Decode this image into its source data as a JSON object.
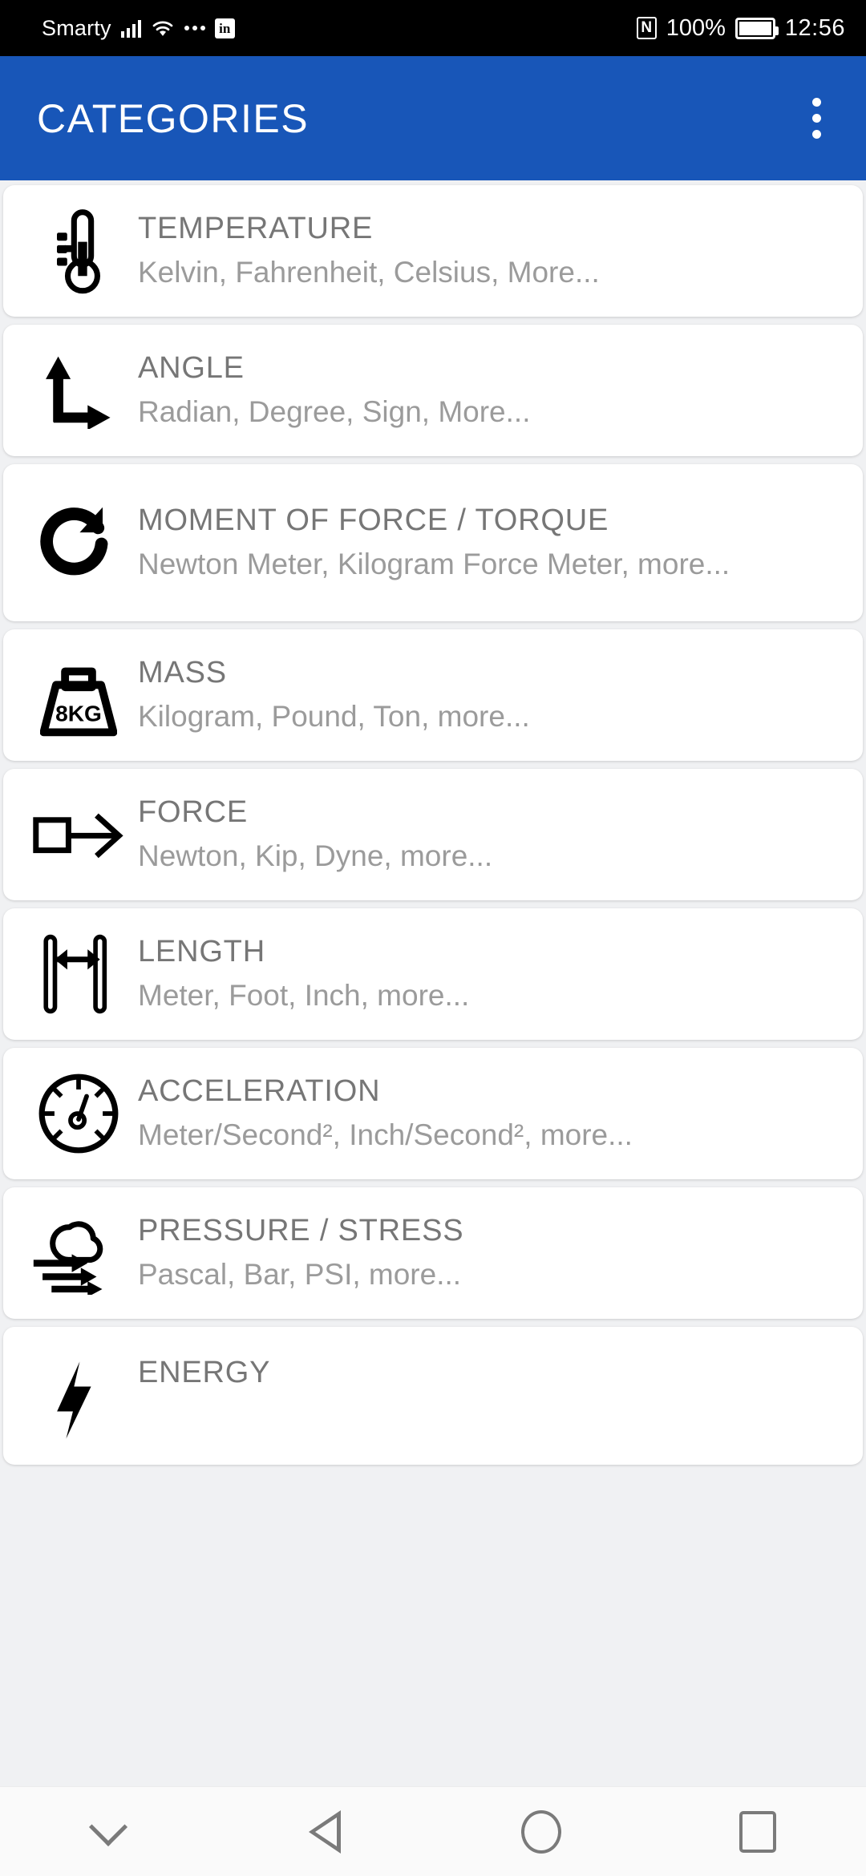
{
  "status_bar": {
    "carrier": "Smarty",
    "icons": [
      "signal-icon",
      "wifi-icon",
      "dots-icon",
      "linkedin-icon"
    ],
    "linkedin_label": "in",
    "nfc_label": "N",
    "battery_percent": "100%",
    "time": "12:56"
  },
  "app_bar": {
    "title": "CATEGORIES",
    "overflow_label": "more-options",
    "background_color": "#1856b8",
    "title_color": "#ffffff"
  },
  "list": {
    "items": [
      {
        "icon": "thermometer-icon",
        "title": "TEMPERATURE",
        "subtitle": "Kelvin, Fahrenheit, Celsius, More..."
      },
      {
        "icon": "angle-arrows-icon",
        "title": "ANGLE",
        "subtitle": "Radian, Degree, Sign, More..."
      },
      {
        "icon": "rotation-arrow-icon",
        "title": "MOMENT OF FORCE / TORQUE",
        "subtitle": "Newton Meter, Kilogram Force Meter, more..."
      },
      {
        "icon": "weight-icon",
        "icon_label": "8KG",
        "title": "MASS",
        "subtitle": "Kilogram, Pound, Ton, more..."
      },
      {
        "icon": "box-arrow-icon",
        "title": "FORCE",
        "subtitle": "Newton, Kip, Dyne, more..."
      },
      {
        "icon": "measure-width-icon",
        "title": "LENGTH",
        "subtitle": "Meter, Foot, Inch, more..."
      },
      {
        "icon": "speedometer-icon",
        "title": "ACCELERATION",
        "subtitle": "Meter/Second², Inch/Second², more..."
      },
      {
        "icon": "cloud-wind-icon",
        "title": "PRESSURE / STRESS",
        "subtitle": "Pascal, Bar, PSI, more..."
      },
      {
        "icon": "lightning-bolt-icon",
        "title": "ENERGY",
        "subtitle": ""
      }
    ]
  },
  "nav_bar": {
    "buttons": [
      "hide-keyboard-icon",
      "back-icon",
      "home-icon",
      "recents-icon"
    ]
  },
  "colors": {
    "accent": "#1856b8",
    "title_text": "#767676",
    "subtitle_text": "#9b9b9b",
    "page_background": "#f0f1f3",
    "card_background": "#ffffff"
  }
}
